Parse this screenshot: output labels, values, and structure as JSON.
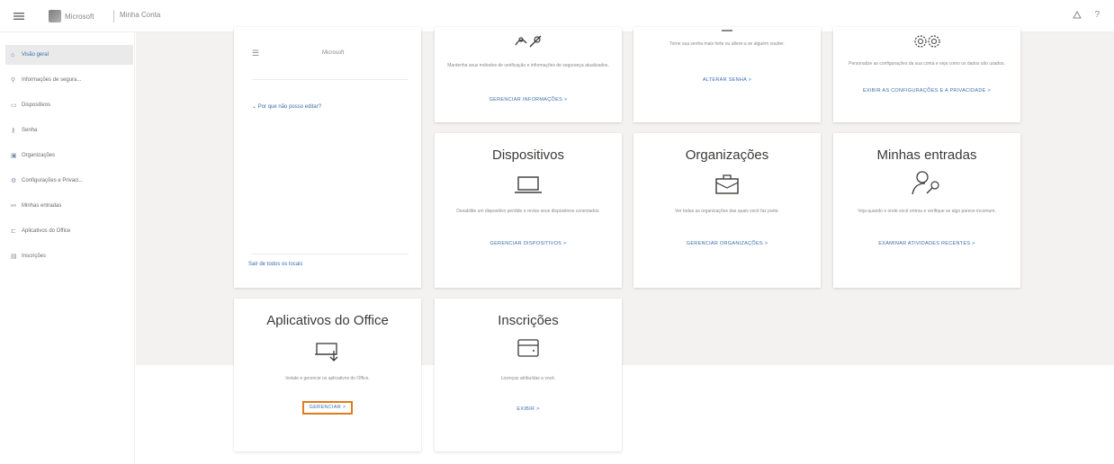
{
  "topbar": {
    "logo_text": "Microsoft",
    "app_title": "Minha Conta",
    "icons": [
      "waffle-icon",
      "user-icon",
      "help-icon"
    ]
  },
  "sidebar": {
    "items": [
      {
        "label": "Visão geral",
        "icon": "home-icon",
        "active": true
      },
      {
        "label": "Informações de segura...",
        "icon": "security-info-icon",
        "active": false
      },
      {
        "label": "Dispositivos",
        "icon": "devices-icon",
        "active": false
      },
      {
        "label": "Senha",
        "icon": "key-icon",
        "active": false
      },
      {
        "label": "Organizações",
        "icon": "organizations-icon",
        "active": false
      },
      {
        "label": "Configurações e Privaci...",
        "icon": "settings-icon",
        "active": false
      },
      {
        "label": "Minhas entradas",
        "icon": "sign-ins-icon",
        "active": false
      },
      {
        "label": "Aplicativos do Office",
        "icon": "office-icon",
        "active": false
      },
      {
        "label": "Inscrições",
        "icon": "subscriptions-icon",
        "active": false
      }
    ]
  },
  "profile": {
    "label": "Microsoft",
    "why_link": "Por que não posso editar?",
    "bottom_link": "Sair de todos os locais"
  },
  "cards": {
    "security_info": {
      "desc": "Mantenha seus métodos de verificação e informações de segurança atualizados.",
      "link": "GERENCIAR INFORMAÇÕES >"
    },
    "password": {
      "desc": "Torne sua senha mais forte ou altere-a se alguém souber.",
      "link": "ALTERAR SENHA >"
    },
    "settings": {
      "desc": "Personalize as configurações da sua conta e veja como os dados são usados.",
      "link": "EXIBIR AS CONFIGURAÇÕES E A PRIVACIDADE >"
    },
    "devices": {
      "title": "Dispositivos",
      "desc": "Desabilite um dispositivo perdido e revise seus dispositivos conectados.",
      "link": "GERENCIAR DISPOSITIVOS >"
    },
    "organizations": {
      "title": "Organizações",
      "desc": "Ver todas as organizações das quais você faz parte.",
      "link": "GERENCIAR ORGANIZAÇÕES >"
    },
    "signins": {
      "title": "Minhas entradas",
      "desc": "Veja quando e onde você entrou e verifique se algo parece incomum.",
      "link": "EXAMINAR ATIVIDADES RECENTES >"
    },
    "office": {
      "title": "Aplicativos do Office",
      "desc": "Instale e gerencie os aplicativos do Office.",
      "link": "GERENCIAR >"
    },
    "subscriptions": {
      "title": "Inscrições",
      "desc": "Licenças atribuídas a você.",
      "link": "EXIBIR >"
    }
  },
  "colors": {
    "accent": "#3a6db0",
    "highlight": "#e07b1e",
    "background": "#f3f2f1"
  }
}
